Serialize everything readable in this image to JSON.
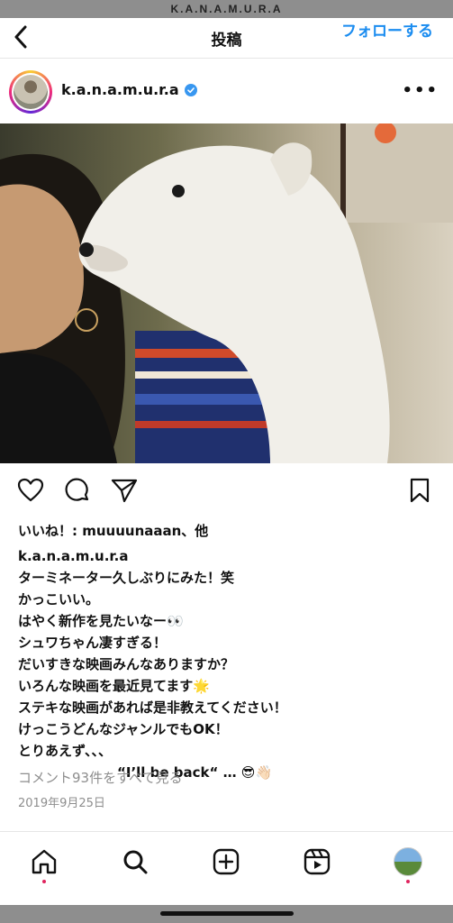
{
  "status": {
    "watermark": "K.A.N.A.M.U.R.A"
  },
  "header": {
    "title": "投稿",
    "follow_label": "フォローする"
  },
  "post": {
    "username": "k.a.n.a.m.u.r.a",
    "likes_text": "いいね！: muuuunaaan、他",
    "caption_user": "k.a.n.a.m.u.r.a",
    "caption_lines": [
      "ターミネーター久しぶりにみた！笑",
      "かっこいい。",
      "はやく新作を見たいなー👀",
      "シュワちゃん凄すぎる！",
      "だいすきな映画みんなありますか？",
      "いろんな映画を最近見てます🌟",
      "ステキな映画があれば是非教えてください！",
      "けっこうどんなジャンルでもOK！",
      "とりあえず、、、",
      "“I’ll be back“ … 😎👋🏻"
    ],
    "comments_link": "コメント93件をすべて見る",
    "date": "2019年9月25日"
  },
  "colors": {
    "accent": "#1a8cf0",
    "notification_dot": "#e0245e",
    "verified": "#3897f0"
  },
  "icons": {
    "back": "chevron-left-icon",
    "more": "more-horizontal-icon",
    "like": "heart-icon",
    "comment": "comment-icon",
    "share": "send-icon",
    "save": "bookmark-icon",
    "nav": [
      "home-icon",
      "search-icon",
      "create-icon",
      "reels-icon",
      "profile-avatar"
    ]
  }
}
